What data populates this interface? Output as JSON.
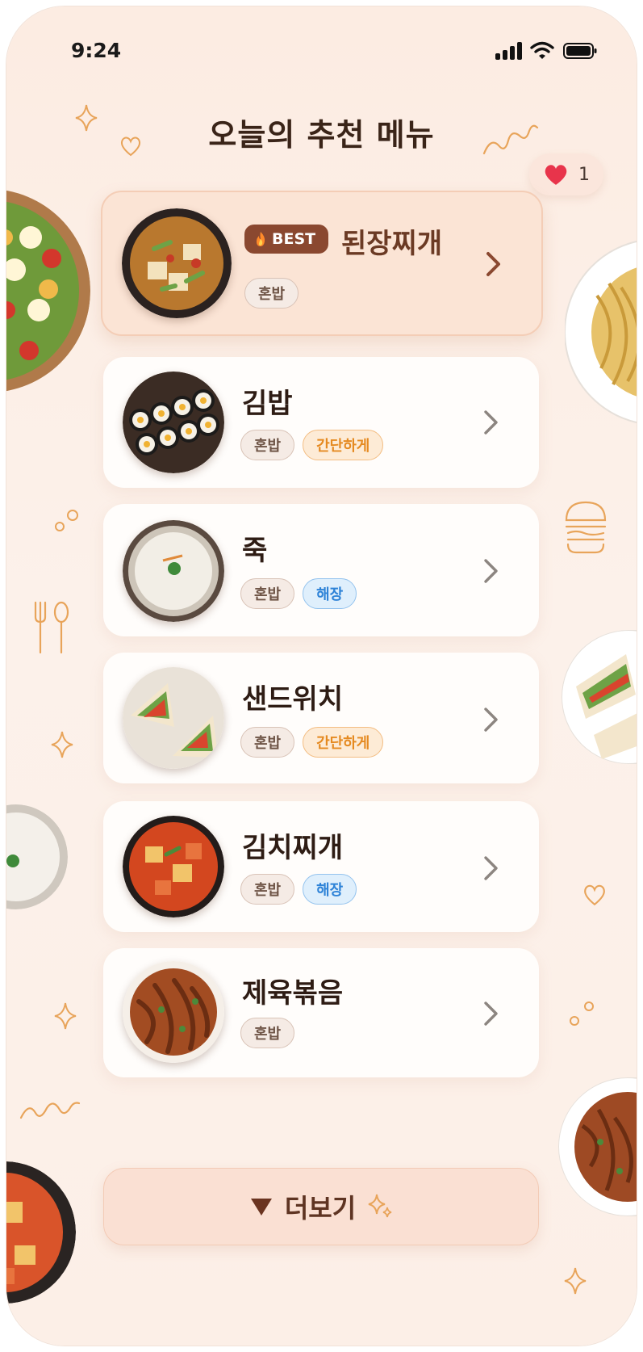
{
  "status_bar": {
    "time": "9:24"
  },
  "page": {
    "title": "오늘의 추천 메뉴"
  },
  "likes": {
    "count": "1"
  },
  "menu": [
    {
      "name": "된장찌개",
      "best": true,
      "best_label": "BEST",
      "tags": [
        {
          "label": "혼밥",
          "style": "gray"
        }
      ],
      "dish": "doenjang-stew"
    },
    {
      "name": "김밥",
      "best": false,
      "tags": [
        {
          "label": "혼밥",
          "style": "gray"
        },
        {
          "label": "간단하게",
          "style": "orange"
        }
      ],
      "dish": "gimbap"
    },
    {
      "name": "죽",
      "best": false,
      "tags": [
        {
          "label": "혼밥",
          "style": "gray"
        },
        {
          "label": "해장",
          "style": "blue"
        }
      ],
      "dish": "porridge"
    },
    {
      "name": "샌드위치",
      "best": false,
      "tags": [
        {
          "label": "혼밥",
          "style": "gray"
        },
        {
          "label": "간단하게",
          "style": "orange"
        }
      ],
      "dish": "sandwich"
    },
    {
      "name": "김치찌개",
      "best": false,
      "tags": [
        {
          "label": "혼밥",
          "style": "gray"
        },
        {
          "label": "해장",
          "style": "blue"
        }
      ],
      "dish": "kimchi-stew"
    },
    {
      "name": "제육볶음",
      "best": false,
      "tags": [
        {
          "label": "혼밥",
          "style": "gray"
        }
      ],
      "dish": "jeyuk-bokkeum"
    }
  ],
  "more_button": {
    "label": "더보기"
  },
  "colors": {
    "accent": "#8a4830",
    "background": "#fcefe7",
    "title": "#3a2418",
    "heart": "#e8344b"
  }
}
